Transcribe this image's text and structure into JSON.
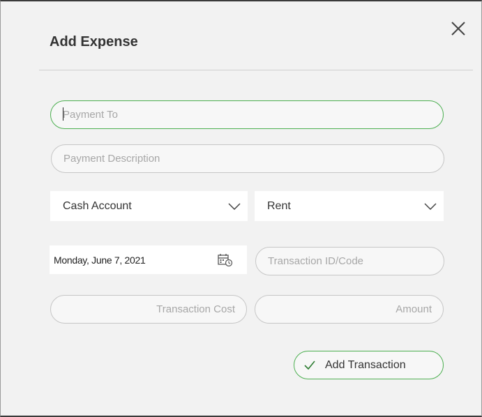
{
  "dialog": {
    "title": "Add Expense"
  },
  "form": {
    "payment_to_placeholder": "Payment To",
    "payment_description_placeholder": "Payment Description",
    "account_select_value": "Cash Account",
    "category_select_value": "Rent",
    "date_value": "Monday, June 7, 2021",
    "transaction_id_placeholder": "Transaction ID/Code",
    "transaction_cost_placeholder": "Transaction Cost",
    "amount_placeholder": "Amount"
  },
  "actions": {
    "add_transaction_label": "Add Transaction"
  },
  "colors": {
    "accent": "#4caf50",
    "background": "#f2f2f2"
  }
}
